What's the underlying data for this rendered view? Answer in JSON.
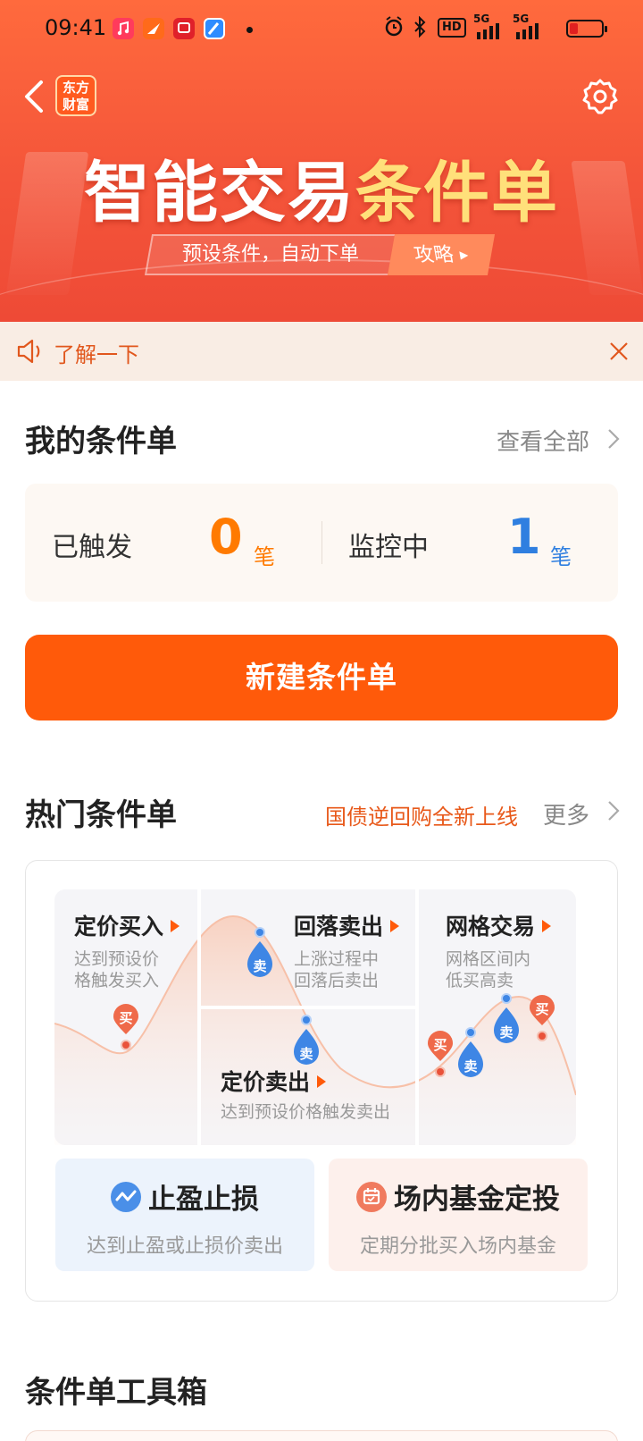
{
  "status_bar": {
    "time": "09:41",
    "hd_label": "HD",
    "net1": "5G",
    "net2": "5G"
  },
  "header": {
    "logo_text_line1": "东方",
    "logo_text_line2": "财富",
    "title_white": "智能交易",
    "title_gold": "条件单",
    "subtitle": "预设条件，自动下单",
    "guide_label": "攻略"
  },
  "notice": {
    "text": "了解一下"
  },
  "my_orders": {
    "title": "我的条件单",
    "view_all": "查看全部",
    "triggered_label": "已触发",
    "triggered_count": "0",
    "triggered_unit": "笔",
    "monitoring_label": "监控中",
    "monitoring_count": "1",
    "monitoring_unit": "笔",
    "new_button": "新建条件单"
  },
  "hot_orders": {
    "title": "热门条件单",
    "promo": "国债逆回购全新上线",
    "more": "更多",
    "panels": [
      {
        "title": "定价买入",
        "desc1": "达到预设价",
        "desc2": "格触发买入"
      },
      {
        "title": "回落卖出",
        "desc1": "上涨过程中",
        "desc2": "回落后卖出"
      },
      {
        "title": "网格交易",
        "desc1": "网格区间内",
        "desc2": "低买高卖"
      },
      {
        "title": "定价卖出",
        "desc1": "达到预设价格触发卖出"
      }
    ],
    "markers": {
      "buy": "买",
      "sell": "卖"
    },
    "mini_cards": [
      {
        "title": "止盈止损",
        "desc": "达到止盈或止损价卖出"
      },
      {
        "title": "场内基金定投",
        "desc": "定期分批买入场内基金"
      }
    ]
  },
  "toolbox": {
    "title": "条件单工具箱"
  },
  "colors": {
    "brand_orange": "#ff5a0a",
    "count_orange": "#ff7a00",
    "count_blue": "#2f7fe0",
    "promo_orange": "#e8591a"
  }
}
